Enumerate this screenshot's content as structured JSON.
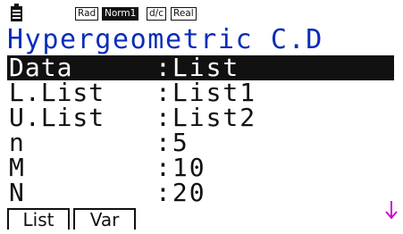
{
  "status_bar": {
    "icons": [
      "battery-icon"
    ],
    "badges": {
      "angle": "Rad",
      "display": "Norm1",
      "fraction": "d/c",
      "complex": "Real"
    }
  },
  "title": "Hypergeometric C.D",
  "rows": [
    {
      "label": "Data",
      "sep": ":",
      "value": "List",
      "selected": true
    },
    {
      "label": "L.List",
      "sep": ":",
      "value": "List1",
      "selected": false
    },
    {
      "label": "U.List",
      "sep": ":",
      "value": "List2",
      "selected": false
    },
    {
      "label": "n",
      "sep": ":",
      "value": "5",
      "selected": false
    },
    {
      "label": "M",
      "sep": ":",
      "value": "10",
      "selected": false
    },
    {
      "label": "N",
      "sep": ":",
      "value": "20",
      "selected": false
    }
  ],
  "more_indicator": {
    "icon": "arrow-down-icon",
    "color": "#d000d0"
  },
  "function_keys": [
    "List",
    "Var"
  ],
  "colors": {
    "title": "#0b2db8",
    "highlight_bg": "#111111",
    "highlight_fg": "#ffffff"
  }
}
